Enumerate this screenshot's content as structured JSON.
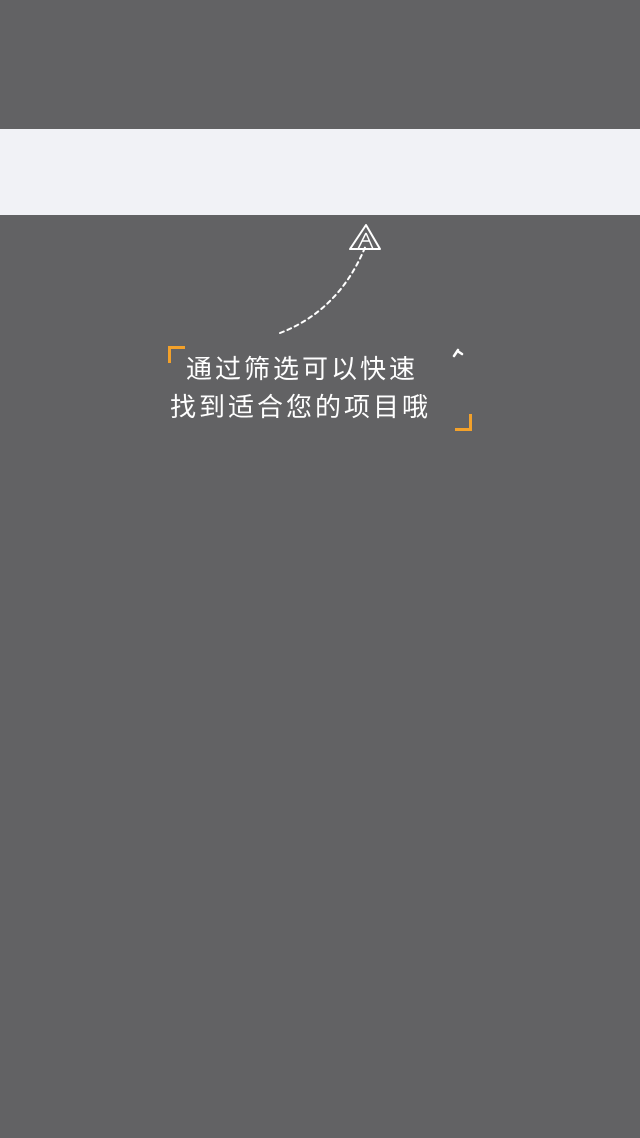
{
  "overlay": {
    "background_color": "#626264",
    "highlight_color": "#f1f2f6",
    "accent_color": "#f3a12a"
  },
  "guide": {
    "line1": "通过筛选可以快速",
    "line2": "找到适合您的项目哦",
    "arrow_icon": "dashed-curved-arrow-up"
  }
}
